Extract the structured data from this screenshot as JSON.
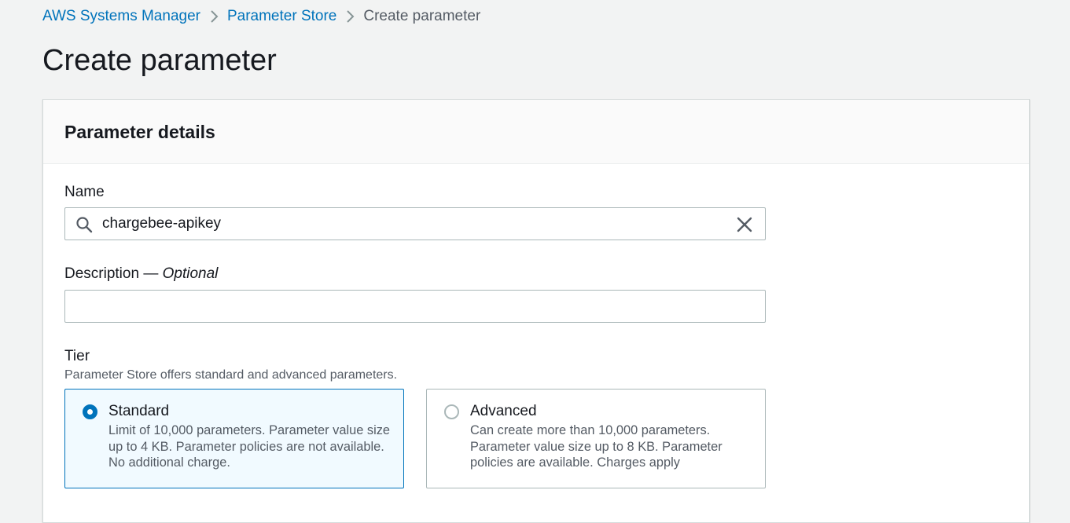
{
  "breadcrumb": {
    "items": [
      {
        "label": "AWS Systems Manager"
      },
      {
        "label": "Parameter Store"
      },
      {
        "label": "Create parameter"
      }
    ]
  },
  "page": {
    "title": "Create parameter"
  },
  "panel": {
    "title": "Parameter details",
    "name": {
      "label": "Name",
      "value": "chargebee-apikey"
    },
    "description": {
      "label": "Description",
      "label_suffix": " — ",
      "optional": "Optional",
      "value": ""
    },
    "tier": {
      "label": "Tier",
      "hint": "Parameter Store offers standard and advanced parameters.",
      "options": [
        {
          "title": "Standard",
          "description": "Limit of 10,000 parameters. Parameter value size up to 4 KB. Parameter policies are not available. No additional charge.",
          "selected": true
        },
        {
          "title": "Advanced",
          "description": "Can create more than 10,000 parameters. Parameter value size up to 8 KB. Parameter policies are available. Charges apply",
          "selected": false
        }
      ]
    }
  },
  "colors": {
    "link": "#0073bb",
    "accent": "#0073bb",
    "selected_tile_bg": "#f1faff",
    "background": "#f2f3f3"
  },
  "icons": {
    "separator": "chevron-right-icon",
    "search": "search-icon",
    "clear": "close-icon"
  }
}
